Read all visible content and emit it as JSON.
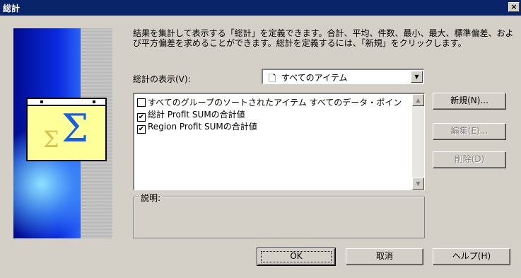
{
  "window": {
    "title": "総計",
    "close_label": "×"
  },
  "description": "結果を集計して表示する「総計」を定義できます。合計、平均、件数、最小、最大、標準偏差、および平方偏差を求めることができます。総計を定義するには、「新規」をクリックします。",
  "show": {
    "label": "総計の表示(V):",
    "selected": "すべてのアイテム",
    "icon": "document-icon"
  },
  "totals_list": [
    {
      "label": "すべてのグループのソートされたアイテム すべてのデータ・ポイン",
      "checked": false
    },
    {
      "label": "総計 Profit SUMの合計値",
      "checked": true
    },
    {
      "label": "Region Profit SUMの合計値",
      "checked": true
    }
  ],
  "description_box": {
    "label": "説明:",
    "text": ""
  },
  "side_buttons": {
    "new": "新規(N)...",
    "edit": "編集(E)...",
    "delete": "削除(D)"
  },
  "footer_buttons": {
    "ok": "OK",
    "cancel": "取消",
    "help": "ヘルプ(H)"
  },
  "colors": {
    "titlebar": "#0a246a",
    "dialog": "#d4d0c8"
  }
}
